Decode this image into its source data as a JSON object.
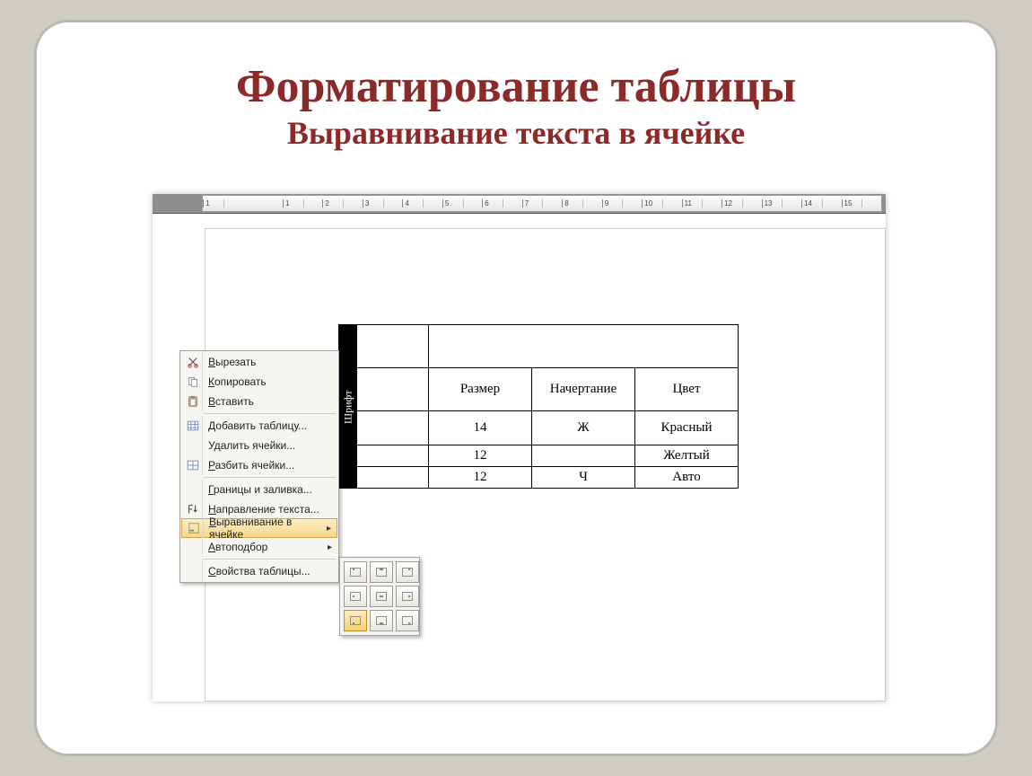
{
  "title": "Форматирование таблицы",
  "subtitle": "Выравнивание текста в ячейке",
  "table": {
    "rot_label": "Шрифт",
    "header_cols": [
      "Размер",
      "Начертание",
      "Цвет"
    ],
    "rows": [
      {
        "size": "14",
        "style": "Ж",
        "color": "Красный"
      },
      {
        "size": "12",
        "style": "",
        "color": "Желтый"
      },
      {
        "size": "12",
        "style": "Ч",
        "color": "Авто"
      }
    ]
  },
  "ctx": {
    "items": [
      {
        "icon": "cut",
        "label": "Вырезать",
        "ul": 0
      },
      {
        "icon": "copy",
        "label": "Копировать",
        "ul": 0
      },
      {
        "icon": "paste",
        "label": "Вставить",
        "ul": 0
      },
      {
        "sep": true
      },
      {
        "icon": "tableins",
        "label": "Добавить таблицу...",
        "ul": 0
      },
      {
        "icon": "",
        "label": "Удалить ячейки...",
        "ul": -1
      },
      {
        "icon": "split",
        "label": "Разбить ячейки...",
        "ul": 0
      },
      {
        "sep": true
      },
      {
        "icon": "",
        "label": "Границы и заливка...",
        "ul": 0
      },
      {
        "icon": "textdir",
        "label": "Направление текста...",
        "ul": 0
      },
      {
        "icon": "align",
        "label": "Выравнивание в ячейке",
        "ul": 0,
        "submenu": true,
        "active": true
      },
      {
        "icon": "",
        "label": "Автоподбор",
        "ul": 0,
        "submenu": true
      },
      {
        "sep": true
      },
      {
        "icon": "",
        "label": "Свойства таблицы...",
        "ul": 0
      }
    ]
  },
  "align_flyout": {
    "cells": [
      "tl",
      "tc",
      "tr",
      "ml",
      "mc",
      "mr",
      "bl",
      "bc",
      "br"
    ],
    "names": [
      "align-top-left",
      "align-top-center",
      "align-top-right",
      "align-middle-left",
      "align-middle-center",
      "align-middle-right",
      "align-bottom-left",
      "align-bottom-center",
      "align-bottom-right"
    ],
    "selected": "bl"
  }
}
